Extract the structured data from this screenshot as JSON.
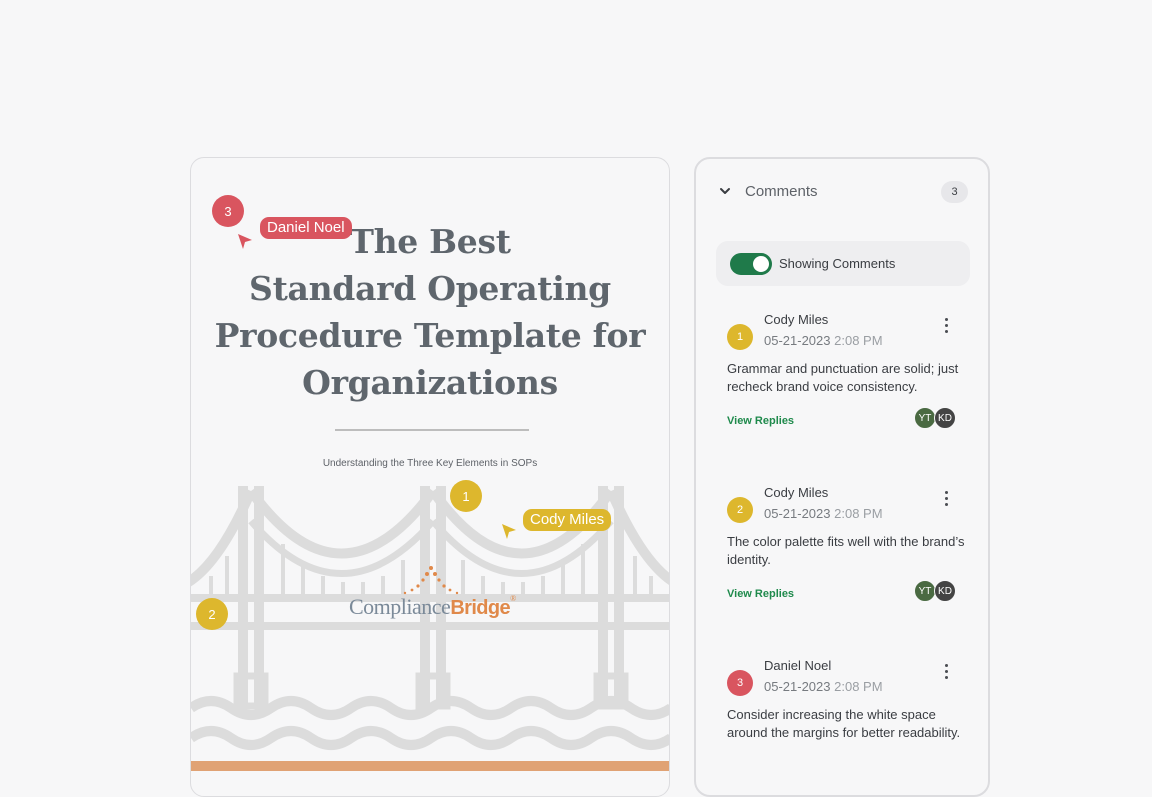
{
  "document": {
    "title_lines": [
      "The Best",
      "Standard Operating",
      "Procedure Template for",
      "Organizations"
    ],
    "subtitle": "Understanding the Three Key Elements in SOPs",
    "logo": {
      "part1": "Compliance",
      "part2": "Bridge",
      "mark": "®"
    },
    "markers": [
      {
        "number": "3",
        "user": "Daniel Noel",
        "color": "#d9555f"
      },
      {
        "number": "1",
        "user": "Cody Miles",
        "color": "#ddb72d"
      },
      {
        "number": "2",
        "color": "#ddb72d"
      }
    ]
  },
  "panel": {
    "title": "Comments",
    "count": "3",
    "toggle_label": "Showing Comments",
    "toggle_on": true,
    "comments": [
      {
        "number": "1",
        "author": "Cody Miles",
        "date": "05-21-2023",
        "time": "2:08 PM",
        "text": "Grammar and punctuation are solid; just recheck brand voice consistency.",
        "link": "View Replies",
        "avatars": [
          "YT",
          "KD"
        ]
      },
      {
        "number": "2",
        "author": "Cody Miles",
        "date": "05-21-2023",
        "time": "2:08 PM",
        "text": "The color palette fits well with the brand’s identity.",
        "link": "View Replies",
        "avatars": [
          "YT",
          "KD"
        ]
      },
      {
        "number": "3",
        "author": "Daniel Noel",
        "date": "05-21-2023",
        "time": "2:08 PM",
        "text": "Consider increasing the white space around the margins for better readability."
      }
    ]
  }
}
